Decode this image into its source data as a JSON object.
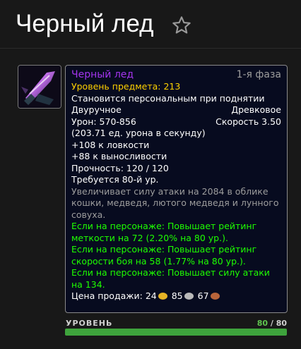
{
  "header": {
    "title": "Черный лед",
    "star_icon": "star-outline-icon"
  },
  "item": {
    "icon": "ice-claw-weapon-icon",
    "name": "Черный лед",
    "phase": "1-я фаза",
    "item_level": "Уровень предмета: 213",
    "binding": "Становится персональным при поднятии",
    "hand": "Двуручное",
    "weapon_type": "Древковое",
    "damage": "Урон: 570-856",
    "speed": "Скорость 3.50",
    "dps": "(203.71 ед. урона в секунду)",
    "stat_agility": "+108 к ловкости",
    "stat_stamina": "+88 к выносливости",
    "durability": "Прочность: 120 / 120",
    "required_level": "Требуется 80-й ур.",
    "feral_bonus": "Увеличивает силу атаки на 2084 в облике кошки, медведя, лютого медведя и лунного совуха.",
    "equip_hit": "Если на персонаже: Повышает рейтинг меткости на 72 (2.20% на 80 ур.).",
    "equip_haste": "Если на персонаже: Повышает рейтинг скорости боя на 58 (1.77% на 80 ур.).",
    "equip_ap": "Если на персонаже: Повышает силу атаки на 134.",
    "sell_price_label": "Цена продажи:",
    "gold": "24",
    "silver": "85",
    "copper": "67",
    "colors": {
      "epic": "#a335ee",
      "item_level": "#ffd100",
      "equip": "#1eff00",
      "gray": "#9d9d9d"
    }
  },
  "level": {
    "label": "УРОВЕНЬ",
    "current": "80",
    "separator": " / ",
    "max": "80",
    "progress": 1.0,
    "bar_color": "#3ea33c"
  }
}
